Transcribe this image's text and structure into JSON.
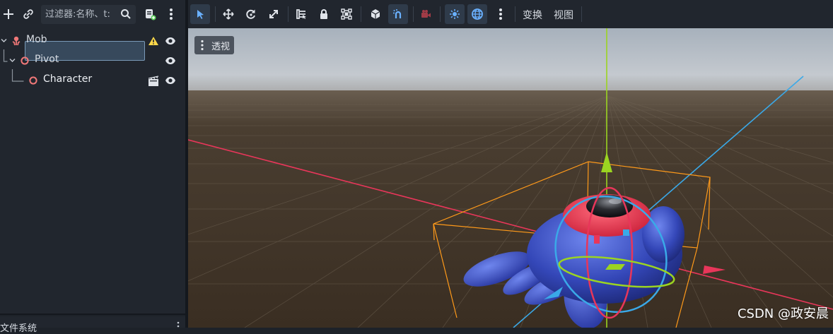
{
  "scene_dock": {
    "filter_placeholder": "过滤器:名称、t:",
    "tree": [
      {
        "label": "Mob",
        "icon": "mob-node-icon",
        "warning": true
      },
      {
        "label": "Pivot",
        "icon": "node3d-icon"
      },
      {
        "label": "Character",
        "icon": "node3d-icon",
        "selected": true
      }
    ],
    "bottom_tab": "文件系统"
  },
  "viewport_toolbar": {
    "transform_menu": "变换",
    "view_menu": "视图"
  },
  "viewport": {
    "perspective_label": "透视",
    "watermark": "CSDN @政安晨"
  },
  "colors": {
    "x_axis": "#e8365a",
    "y_axis": "#9bd421",
    "z_axis": "#3aa9e8",
    "selection_box": "#ff9a1a",
    "mob_body": "#3a4fc0",
    "mob_ring": "#e6304a",
    "warning": "#ffd84a"
  }
}
